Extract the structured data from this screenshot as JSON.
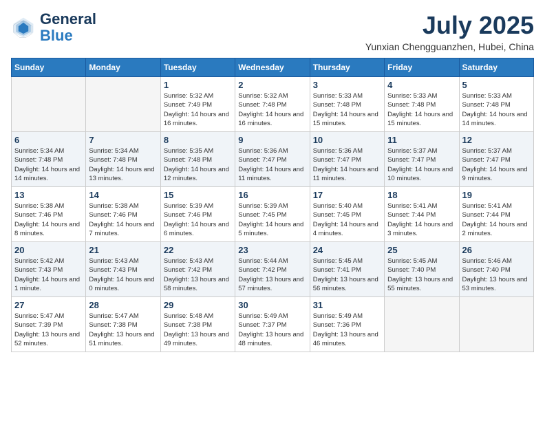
{
  "logo": {
    "text_general": "General",
    "text_blue": "Blue"
  },
  "title": "July 2025",
  "location": "Yunxian Chengguanzhen, Hubei, China",
  "days_of_week": [
    "Sunday",
    "Monday",
    "Tuesday",
    "Wednesday",
    "Thursday",
    "Friday",
    "Saturday"
  ],
  "weeks": [
    {
      "shaded": false,
      "days": [
        {
          "num": "",
          "empty": true
        },
        {
          "num": "",
          "empty": true
        },
        {
          "num": "1",
          "sunrise": "5:32 AM",
          "sunset": "7:49 PM",
          "daylight": "14 hours and 16 minutes."
        },
        {
          "num": "2",
          "sunrise": "5:32 AM",
          "sunset": "7:48 PM",
          "daylight": "14 hours and 16 minutes."
        },
        {
          "num": "3",
          "sunrise": "5:33 AM",
          "sunset": "7:48 PM",
          "daylight": "14 hours and 15 minutes."
        },
        {
          "num": "4",
          "sunrise": "5:33 AM",
          "sunset": "7:48 PM",
          "daylight": "14 hours and 15 minutes."
        },
        {
          "num": "5",
          "sunrise": "5:33 AM",
          "sunset": "7:48 PM",
          "daylight": "14 hours and 14 minutes."
        }
      ]
    },
    {
      "shaded": true,
      "days": [
        {
          "num": "6",
          "sunrise": "5:34 AM",
          "sunset": "7:48 PM",
          "daylight": "14 hours and 14 minutes."
        },
        {
          "num": "7",
          "sunrise": "5:34 AM",
          "sunset": "7:48 PM",
          "daylight": "14 hours and 13 minutes."
        },
        {
          "num": "8",
          "sunrise": "5:35 AM",
          "sunset": "7:48 PM",
          "daylight": "14 hours and 12 minutes."
        },
        {
          "num": "9",
          "sunrise": "5:36 AM",
          "sunset": "7:47 PM",
          "daylight": "14 hours and 11 minutes."
        },
        {
          "num": "10",
          "sunrise": "5:36 AM",
          "sunset": "7:47 PM",
          "daylight": "14 hours and 11 minutes."
        },
        {
          "num": "11",
          "sunrise": "5:37 AM",
          "sunset": "7:47 PM",
          "daylight": "14 hours and 10 minutes."
        },
        {
          "num": "12",
          "sunrise": "5:37 AM",
          "sunset": "7:47 PM",
          "daylight": "14 hours and 9 minutes."
        }
      ]
    },
    {
      "shaded": false,
      "days": [
        {
          "num": "13",
          "sunrise": "5:38 AM",
          "sunset": "7:46 PM",
          "daylight": "14 hours and 8 minutes."
        },
        {
          "num": "14",
          "sunrise": "5:38 AM",
          "sunset": "7:46 PM",
          "daylight": "14 hours and 7 minutes."
        },
        {
          "num": "15",
          "sunrise": "5:39 AM",
          "sunset": "7:46 PM",
          "daylight": "14 hours and 6 minutes."
        },
        {
          "num": "16",
          "sunrise": "5:39 AM",
          "sunset": "7:45 PM",
          "daylight": "14 hours and 5 minutes."
        },
        {
          "num": "17",
          "sunrise": "5:40 AM",
          "sunset": "7:45 PM",
          "daylight": "14 hours and 4 minutes."
        },
        {
          "num": "18",
          "sunrise": "5:41 AM",
          "sunset": "7:44 PM",
          "daylight": "14 hours and 3 minutes."
        },
        {
          "num": "19",
          "sunrise": "5:41 AM",
          "sunset": "7:44 PM",
          "daylight": "14 hours and 2 minutes."
        }
      ]
    },
    {
      "shaded": true,
      "days": [
        {
          "num": "20",
          "sunrise": "5:42 AM",
          "sunset": "7:43 PM",
          "daylight": "14 hours and 1 minute."
        },
        {
          "num": "21",
          "sunrise": "5:43 AM",
          "sunset": "7:43 PM",
          "daylight": "14 hours and 0 minutes."
        },
        {
          "num": "22",
          "sunrise": "5:43 AM",
          "sunset": "7:42 PM",
          "daylight": "13 hours and 58 minutes."
        },
        {
          "num": "23",
          "sunrise": "5:44 AM",
          "sunset": "7:42 PM",
          "daylight": "13 hours and 57 minutes."
        },
        {
          "num": "24",
          "sunrise": "5:45 AM",
          "sunset": "7:41 PM",
          "daylight": "13 hours and 56 minutes."
        },
        {
          "num": "25",
          "sunrise": "5:45 AM",
          "sunset": "7:40 PM",
          "daylight": "13 hours and 55 minutes."
        },
        {
          "num": "26",
          "sunrise": "5:46 AM",
          "sunset": "7:40 PM",
          "daylight": "13 hours and 53 minutes."
        }
      ]
    },
    {
      "shaded": false,
      "days": [
        {
          "num": "27",
          "sunrise": "5:47 AM",
          "sunset": "7:39 PM",
          "daylight": "13 hours and 52 minutes."
        },
        {
          "num": "28",
          "sunrise": "5:47 AM",
          "sunset": "7:38 PM",
          "daylight": "13 hours and 51 minutes."
        },
        {
          "num": "29",
          "sunrise": "5:48 AM",
          "sunset": "7:38 PM",
          "daylight": "13 hours and 49 minutes."
        },
        {
          "num": "30",
          "sunrise": "5:49 AM",
          "sunset": "7:37 PM",
          "daylight": "13 hours and 48 minutes."
        },
        {
          "num": "31",
          "sunrise": "5:49 AM",
          "sunset": "7:36 PM",
          "daylight": "13 hours and 46 minutes."
        },
        {
          "num": "",
          "empty": true
        },
        {
          "num": "",
          "empty": true
        }
      ]
    }
  ]
}
